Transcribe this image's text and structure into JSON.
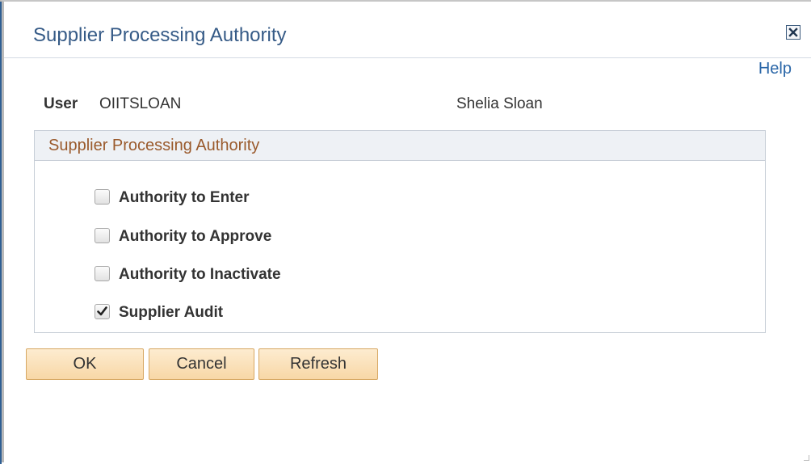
{
  "dialog": {
    "title": "Supplier Processing Authority",
    "close_icon": "close-icon",
    "help_label": "Help"
  },
  "user": {
    "label": "User",
    "id": "OIITSLOAN",
    "name": "Shelia Sloan"
  },
  "group": {
    "header": "Supplier Processing Authority",
    "items": [
      {
        "label": "Authority to Enter",
        "checked": false
      },
      {
        "label": "Authority to Approve",
        "checked": false
      },
      {
        "label": "Authority to Inactivate",
        "checked": false
      },
      {
        "label": "Supplier Audit",
        "checked": true
      }
    ]
  },
  "buttons": {
    "ok": "OK",
    "cancel": "Cancel",
    "refresh": "Refresh"
  },
  "colors": {
    "title": "#365b87",
    "group_header_text": "#9a5a2c",
    "button_fill": "#f8d7a6",
    "button_border": "#d7a864",
    "link": "#2b67a8"
  }
}
